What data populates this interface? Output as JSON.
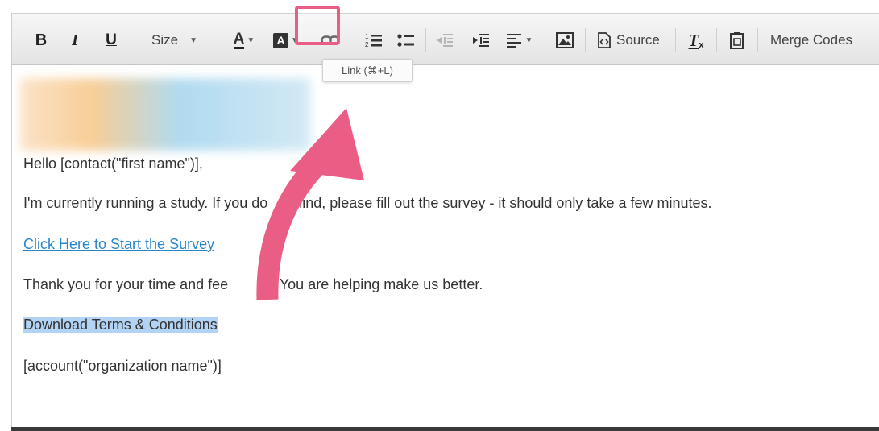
{
  "toolbar": {
    "bold": "B",
    "italic": "I",
    "underline": "U",
    "size_label": "Size",
    "text_color": "A",
    "bg_color": "A",
    "source_label": "Source",
    "clear_format": "T",
    "merge_codes_label": "Merge Codes"
  },
  "tooltip": {
    "text": "Link (⌘+L)"
  },
  "content": {
    "greeting": "Hello [contact(\"first name\")],",
    "message_start": "I'm currently running a study. If you do",
    "message_end": "mind, please fill out the survey - it should only take a few minutes.",
    "survey_link": "Click Here to Start the Survey",
    "thanks_start": "Thank you for your time and fee",
    "thanks_end": "ck. You are helping make us better.",
    "terms": "Download Terms & Conditions",
    "org": "[account(\"organization name\")]"
  },
  "colors": {
    "highlight": "#ea5e86",
    "link": "#2a86c8",
    "selection": "#b3d3f5"
  }
}
